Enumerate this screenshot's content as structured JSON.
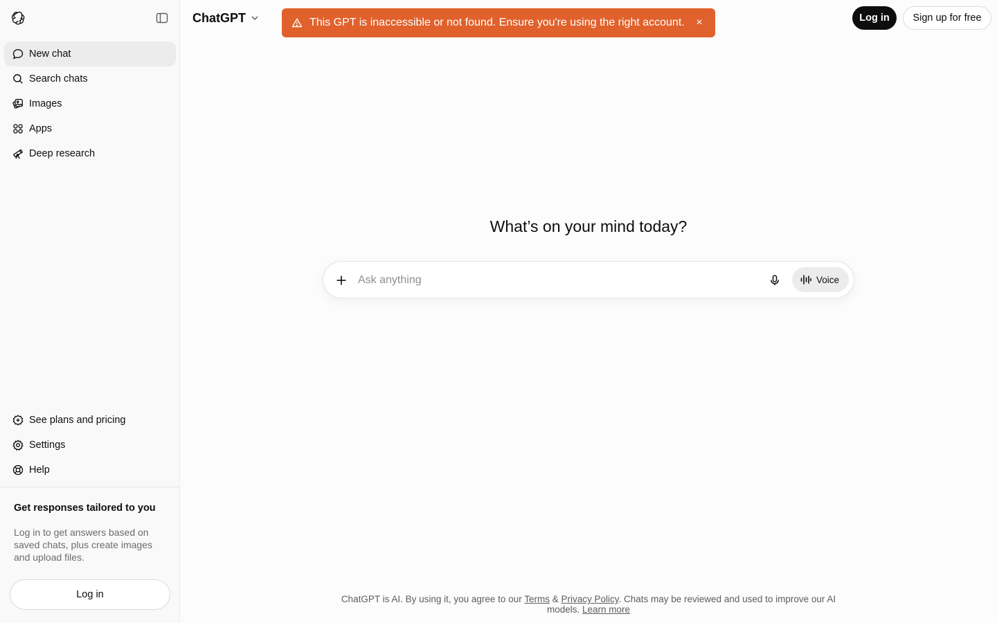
{
  "sidebar": {
    "logo_icon": "openai-logo-icon",
    "toggle_icon": "sidebar-toggle-icon",
    "nav_items": [
      {
        "label": "New chat",
        "icon": "chat-bubble-icon",
        "active": true
      },
      {
        "label": "Search chats",
        "icon": "search-icon"
      },
      {
        "label": "Images",
        "icon": "images-icon"
      },
      {
        "label": "Apps",
        "icon": "apps-grid-icon"
      },
      {
        "label": "Deep research",
        "icon": "telescope-icon"
      }
    ],
    "bottom_items": [
      {
        "label": "See plans and pricing",
        "icon": "plans-icon"
      },
      {
        "label": "Settings",
        "icon": "gear-icon"
      },
      {
        "label": "Help",
        "icon": "help-lifebuoy-icon"
      }
    ],
    "promo": {
      "title": "Get responses tailored to you",
      "text": "Log in to get answers based on saved chats, plus create images and upload files.",
      "login_label": "Log in"
    }
  },
  "header": {
    "model_label": "ChatGPT",
    "login_label": "Log in",
    "signup_label": "Sign up for free"
  },
  "toast": {
    "message": "This GPT is inaccessible or not found. Ensure you're using the right account.",
    "close_glyph": "×",
    "color": "#e0612c"
  },
  "main": {
    "headline": "What’s on your mind today?",
    "composer": {
      "placeholder": "Ask anything",
      "voice_label": "Voice"
    }
  },
  "footer": {
    "prefix": "ChatGPT is AI. By using it, you agree to our ",
    "terms": "Terms",
    "amp": " & ",
    "privacy": "Privacy Policy",
    "middle": ". Chats may be reviewed and used to improve our AI models. ",
    "learn_more": "Learn more"
  }
}
